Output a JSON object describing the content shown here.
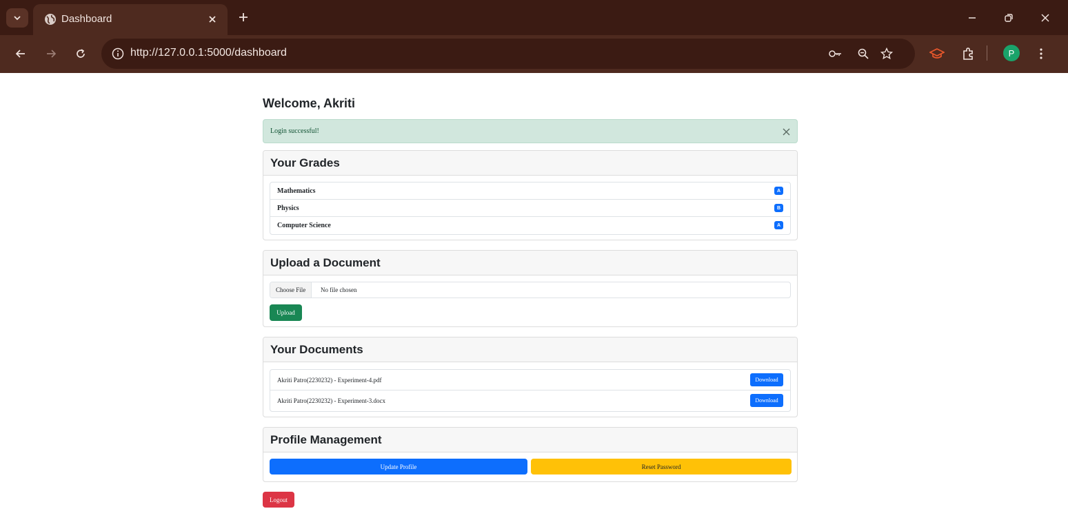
{
  "browser": {
    "tab_title": "Dashboard",
    "url": "http://127.0.0.1:5000/dashboard",
    "profile_initial": "P",
    "colors": {
      "frame": "#3b1b13",
      "toolbar": "#4e2a1f",
      "avatar": "#1aa36a",
      "extension": "#e8572b"
    }
  },
  "page": {
    "welcome": "Welcome, Akriti",
    "alert": {
      "message": "Login successful!",
      "color": "#d1e7dd"
    },
    "grades": {
      "header": "Your Grades",
      "items": [
        {
          "subject": "Mathematics",
          "grade": "A"
        },
        {
          "subject": "Physics",
          "grade": "B"
        },
        {
          "subject": "Computer Science",
          "grade": "A"
        }
      ]
    },
    "upload": {
      "header": "Upload a Document",
      "choose_label": "Choose File",
      "file_status": "No file chosen",
      "button": "Upload"
    },
    "documents": {
      "header": "Your Documents",
      "items": [
        {
          "name": "Akriti Patro(2230232) - Experiment-4.pdf",
          "action": "Download"
        },
        {
          "name": "Akriti Patro(2230232) - Experiment-3.docx",
          "action": "Download"
        }
      ]
    },
    "profile": {
      "header": "Profile Management",
      "update_button": "Update Profile",
      "reset_button": "Reset Password"
    },
    "logout": "Logout",
    "colors": {
      "primary": "#0d6efd",
      "success": "#198754",
      "warning": "#ffc107",
      "danger": "#dc3545"
    }
  }
}
